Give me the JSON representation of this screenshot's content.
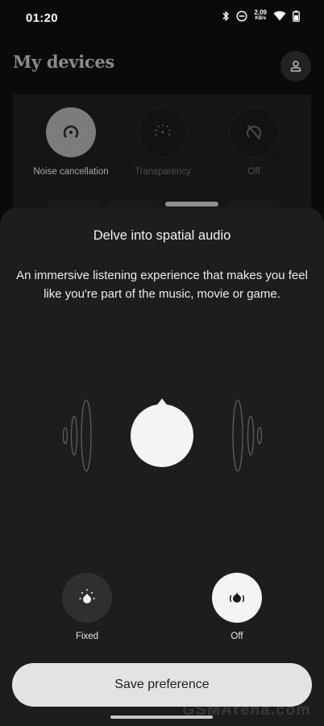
{
  "status_bar": {
    "time": "01:20",
    "net_speed_value": "2.09",
    "net_speed_unit": "KB/s",
    "icons": [
      "bluetooth-icon",
      "dnd-icon",
      "wifi-icon",
      "battery-icon"
    ]
  },
  "page": {
    "title": "My devices",
    "profile_icon": "person-icon"
  },
  "noise_modes": [
    {
      "label": "Noise cancellation",
      "icon": "noise-cancellation-icon",
      "active": true
    },
    {
      "label": "Transparency",
      "icon": "transparency-icon",
      "active": false
    },
    {
      "label": "Off",
      "icon": "anc-off-icon",
      "active": false
    }
  ],
  "sheet": {
    "title": "Delve into spatial audio",
    "description": "An immersive listening experience that makes you feel like you're part of the music, movie or game.",
    "illustration_icon": "spatial-audio-head-icon",
    "options": [
      {
        "label": "Fixed",
        "icon": "fixed-spatial-icon",
        "selected": false
      },
      {
        "label": "Off",
        "icon": "spatial-off-icon",
        "selected": true
      }
    ],
    "save_label": "Save preference"
  },
  "colors": {
    "background": "#0a0a0a",
    "sheet": "#1d1d1d",
    "button": "#e3e3e3",
    "selected_option": "#f4f4f4"
  },
  "watermark": "GSMArena.com"
}
